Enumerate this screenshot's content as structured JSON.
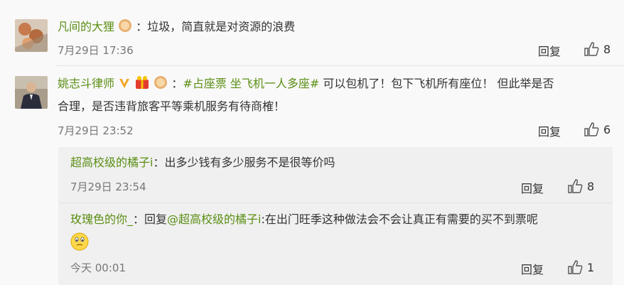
{
  "comments": [
    {
      "user": "凡间的大狸",
      "text": "：垃圾，简直就是对资源的浪费",
      "time": "7月29日 17:36",
      "reply_label": "回复",
      "likes": "8"
    },
    {
      "user": "姚志斗律师",
      "hashtag": "#占座票 坐飞机一人多座#",
      "text_line1": " 可以包机了！包下飞机所有座位！ 但此举是否",
      "text_line2": "合理，是否违背旅客平等乘机服务有待商榷！",
      "time": "7月29日 23:52",
      "reply_label": "回复",
      "likes": "6"
    }
  ],
  "replies": [
    {
      "user": "超高校级的橘子i",
      "text": "：出多少钱有多少服务不是很等价吗",
      "time": "7月29日 23:54",
      "reply_label": "回复",
      "likes": "8"
    },
    {
      "user": "玫瑰色的你_",
      "text_prefix": "：回复",
      "mention": "@超高校级的橘子i",
      "text": ":在出门旺季这种做法会不会让真正有需要的买不到票呢",
      "time": "今天 00:01",
      "reply_label": "回复",
      "likes": "1"
    }
  ],
  "colors": {
    "username": "#5a8e14",
    "time": "#777777",
    "background": "#f9f9f9",
    "reply_bg": "#f0f0f0"
  }
}
